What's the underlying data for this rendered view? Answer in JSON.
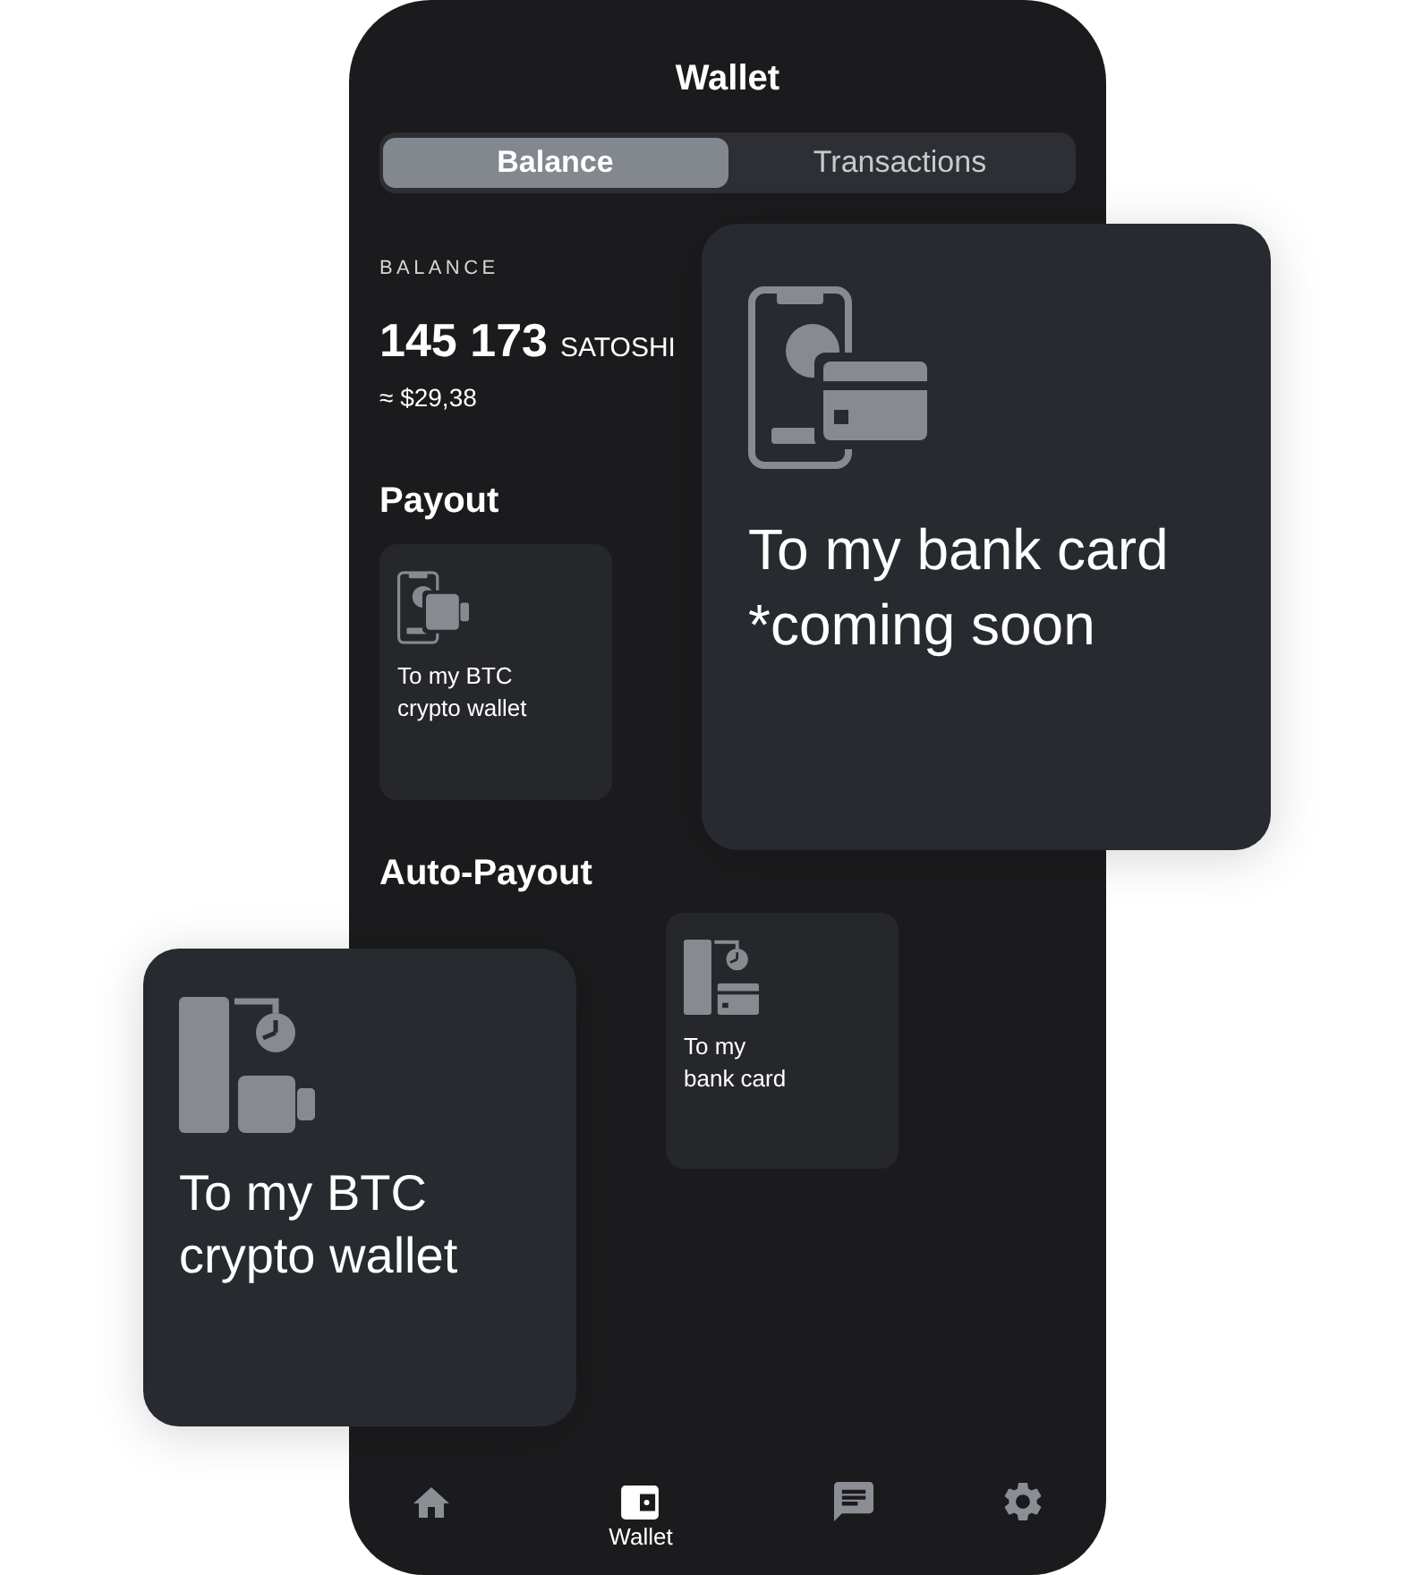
{
  "screen": {
    "title": "Wallet"
  },
  "tabs": [
    {
      "label": "Balance",
      "selected": true
    },
    {
      "label": "Transactions",
      "selected": false
    }
  ],
  "balance": {
    "label": "BALANCE",
    "amount": "145 173",
    "unit": "SATOSHI",
    "fiat": "≈ $29,38"
  },
  "sections": [
    {
      "kind": "payout",
      "heading": "Payout",
      "options": [
        {
          "kind": "crypto_wallet",
          "label": "To my BTC\ncrypto wallet",
          "lifted": false
        },
        {
          "kind": "bank_card",
          "label": "To my bank card\n*coming soon",
          "lifted": true
        }
      ]
    },
    {
      "kind": "auto_payout",
      "heading": "Auto-Payout",
      "options": [
        {
          "kind": "crypto_wallet",
          "label": "To my BTC\ncrypto wallet",
          "lifted": true
        },
        {
          "kind": "bank_card",
          "label": "To my\nbank card",
          "lifted": false
        }
      ]
    }
  ],
  "bottom_nav": [
    {
      "kind": "home",
      "selected": false
    },
    {
      "kind": "wallet",
      "label": "Wallet",
      "selected": true
    },
    {
      "kind": "chat",
      "selected": false
    },
    {
      "kind": "settings",
      "selected": false
    }
  ]
}
